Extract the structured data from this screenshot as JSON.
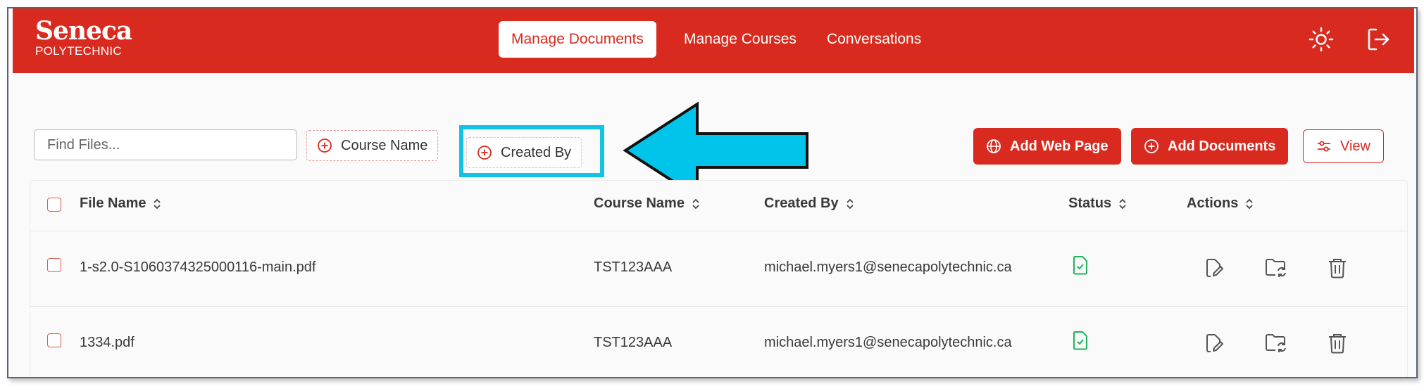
{
  "brand": {
    "name": "Seneca",
    "sub": "POLYTECHNIC"
  },
  "nav": {
    "tabs": [
      {
        "label": "Manage Documents",
        "active": true
      },
      {
        "label": "Manage Courses",
        "active": false
      },
      {
        "label": "Conversations",
        "active": false
      }
    ],
    "icons": [
      "sun-icon",
      "logout-icon"
    ]
  },
  "toolbar": {
    "search_placeholder": "Find Files...",
    "filter_course": "Course Name",
    "filter_created": "Created By",
    "add_web_page": "Add Web Page",
    "add_documents": "Add Documents",
    "view": "View"
  },
  "table": {
    "columns": [
      "File Name",
      "Course Name",
      "Created By",
      "Status",
      "Actions"
    ],
    "rows": [
      {
        "file": "1-s2.0-S1060374325000116-main.pdf",
        "course": "TST123AAA",
        "created_by": "michael.myers1@senecapolytechnic.ca",
        "status": "document-check-icon"
      },
      {
        "file": "1334.pdf",
        "course": "TST123AAA",
        "created_by": "michael.myers1@senecapolytechnic.ca",
        "status": "document-check-icon"
      }
    ]
  },
  "colors": {
    "brand_red": "#d92a1f",
    "highlight": "#14c2e6",
    "status_green": "#22b35a"
  }
}
